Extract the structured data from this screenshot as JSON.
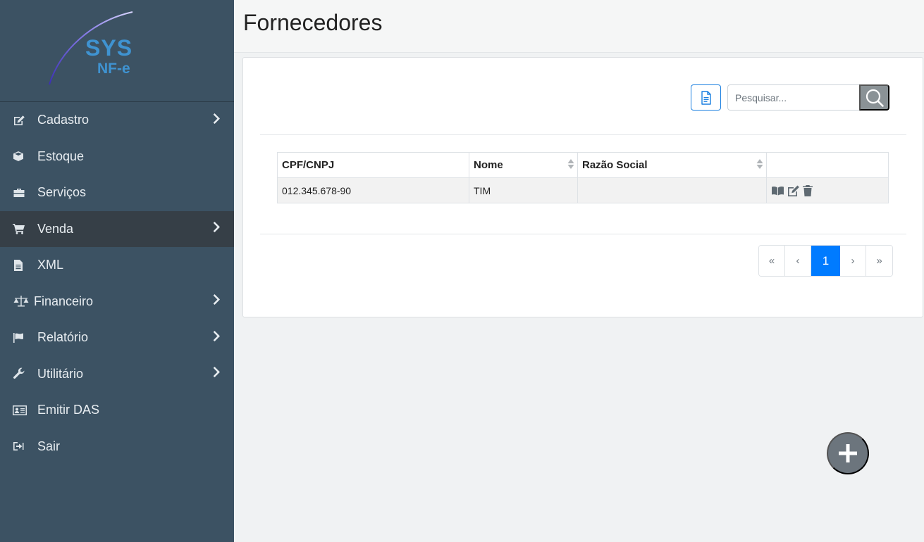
{
  "logo": {
    "line1": "SYS",
    "line2": "NF-e"
  },
  "sidebar": {
    "items": [
      {
        "label": "Cadastro",
        "icon": "edit-icon",
        "has_submenu": true
      },
      {
        "label": "Estoque",
        "icon": "box-icon",
        "has_submenu": false
      },
      {
        "label": "Serviços",
        "icon": "briefcase-icon",
        "has_submenu": false
      },
      {
        "label": "Venda",
        "icon": "cart-icon",
        "has_submenu": true,
        "active": true
      },
      {
        "label": "XML",
        "icon": "file-icon",
        "has_submenu": false
      },
      {
        "label": "Financeiro",
        "icon": "scale-icon",
        "has_submenu": true
      },
      {
        "label": "Relatório",
        "icon": "flag-icon",
        "has_submenu": true
      },
      {
        "label": "Utilitário",
        "icon": "wrench-icon",
        "has_submenu": true
      },
      {
        "label": "Emitir DAS",
        "icon": "id-card-icon",
        "has_submenu": false
      },
      {
        "label": "Sair",
        "icon": "sign-out-icon",
        "has_submenu": false
      }
    ]
  },
  "header": {
    "title": "Fornecedores"
  },
  "toolbar": {
    "search_placeholder": "Pesquisar..."
  },
  "table": {
    "columns": [
      "CPF/CNPJ",
      "Nome",
      "Razão Social",
      ""
    ],
    "rows": [
      {
        "cpf_cnpj": "012.345.678-90",
        "nome": "TIM",
        "razao_social": ""
      }
    ]
  },
  "pagination": {
    "first": "«",
    "prev": "‹",
    "current": "1",
    "next": "›",
    "last": "»"
  },
  "colors": {
    "sidebar": "#3c5263",
    "active_item": "#363f47",
    "primary": "#007bff",
    "logo": "#3f93d1",
    "fab": "#6c757d"
  }
}
